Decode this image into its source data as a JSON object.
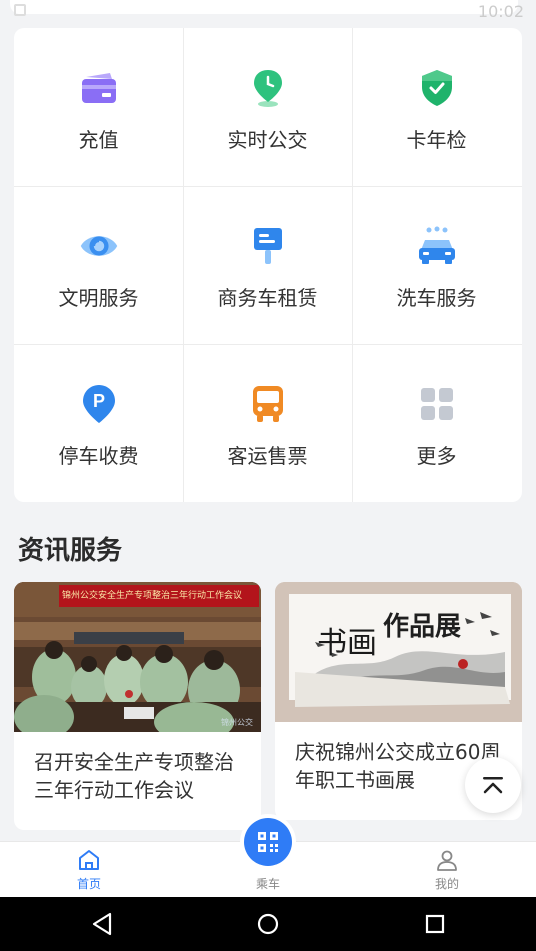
{
  "status_bar": {
    "time": "10:02"
  },
  "services": [
    {
      "label": "充值",
      "icon": "wallet-icon",
      "color": "#8a6ef5"
    },
    {
      "label": "实时公交",
      "icon": "clock-pin-icon",
      "color": "#2ec27e"
    },
    {
      "label": "卡年检",
      "icon": "shield-check-icon",
      "color": "#1fb36b"
    },
    {
      "label": "文明服务",
      "icon": "eye-icon",
      "color": "#3a8ff0"
    },
    {
      "label": "商务车租赁",
      "icon": "sign-icon",
      "color": "#2f86ec"
    },
    {
      "label": "洗车服务",
      "icon": "car-wash-icon",
      "color": "#2f86ec"
    },
    {
      "label": "停车收费",
      "icon": "parking-icon",
      "color": "#2f86ec"
    },
    {
      "label": "客运售票",
      "icon": "bus-icon",
      "color": "#f08a24"
    },
    {
      "label": "更多",
      "icon": "grid-icon",
      "color": "#c4c9d2"
    }
  ],
  "news_section": {
    "title": "资讯服务"
  },
  "news": [
    {
      "title": "召开安全生产专项整治三年行动工作会议",
      "banner_text": "锦州公交安全生产专项整治三年行动工作会议",
      "watermark": "锦州公交"
    },
    {
      "title": "庆祝锦州公交成立60周年职工书画展",
      "banner_text": "作品展",
      "calligraphy": "书画"
    }
  ],
  "tabbar": {
    "home": "首页",
    "ride": "乘车",
    "mine": "我的"
  },
  "colors": {
    "accent": "#2f7cf6"
  }
}
